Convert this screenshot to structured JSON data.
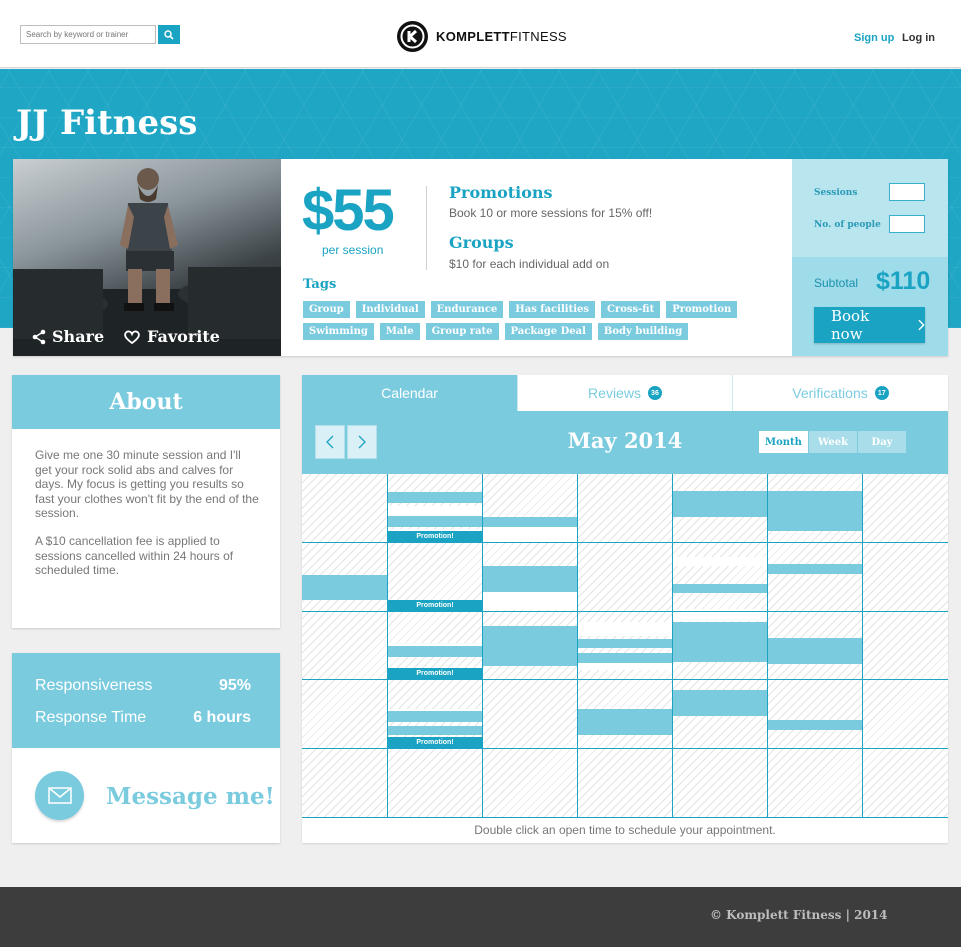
{
  "header": {
    "search_placeholder": "Search by keyword or trainer",
    "logo_bold": "KOMPLETT",
    "logo_light": "FITNESS",
    "signup": "Sign up",
    "login": "Log in"
  },
  "trainer": {
    "name": "JJ Fitness",
    "share": "Share",
    "favorite": "Favorite",
    "price": "$55",
    "price_unit": "per session",
    "promotions_title": "Promotions",
    "promotions_text": "Book 10 or more sessions for 15% off!",
    "groups_title": "Groups",
    "groups_text": "$10 for each individual add on",
    "tags_title": "Tags",
    "tags_row1": [
      "Group",
      "Individual",
      "Endurance",
      "Has facilities",
      "Cross-fit",
      "Promotion"
    ],
    "tags_row2": [
      "Swimming",
      "Male",
      "Group rate",
      "Package Deal",
      "Body building"
    ]
  },
  "booking": {
    "sessions_label": "Sessions",
    "people_label": "No. of people",
    "subtotal_label": "Subtotal",
    "subtotal_value": "$110",
    "book_button": "Book now"
  },
  "about": {
    "title": "About",
    "paragraph1": "Give me one 30 minute session and I'll get your rock solid abs and calves for days. My focus is getting you results so fast your clothes won't fit by the end of the session.",
    "paragraph2": "A $10 cancellation fee is applied to sessions cancelled within 24 hours of scheduled time."
  },
  "stats": {
    "responsiveness_label": "Responsiveness",
    "responsiveness_value": "95%",
    "response_time_label": "Response Time",
    "response_time_value": "6 hours",
    "message_label": "Message me!"
  },
  "calendar": {
    "tabs": [
      {
        "label": "Calendar",
        "count": null
      },
      {
        "label": "Reviews",
        "count": "36"
      },
      {
        "label": "Verifications",
        "count": "17"
      }
    ],
    "active_tab": "Calendar",
    "month_label": "May 2014",
    "views": [
      "Month",
      "Week",
      "Day"
    ],
    "active_view": "Month",
    "promo_label": "Promotion!",
    "footer_hint": "Double click an open time to schedule your appointment."
  },
  "footer": {
    "copyright": "© Komplett Fitness | 2014"
  },
  "colors": {
    "accent": "#1aa3c2",
    "light_accent": "#7bcbdf",
    "footer_bg": "#3d3d3d"
  }
}
